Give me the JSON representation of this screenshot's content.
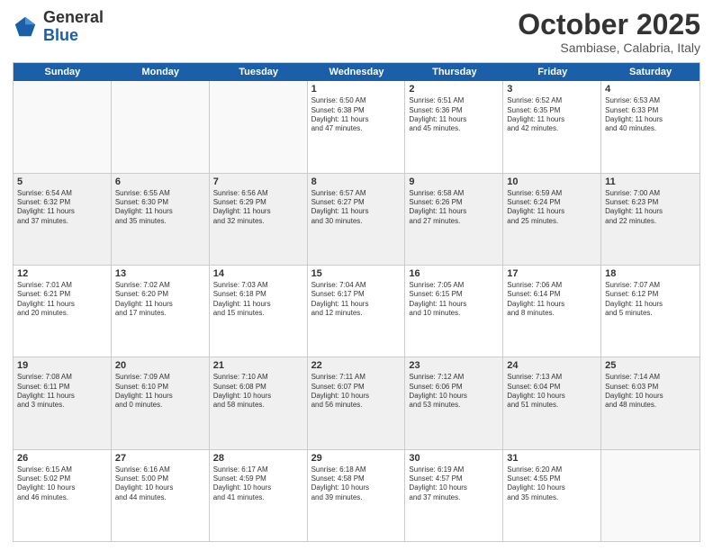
{
  "header": {
    "logo_general": "General",
    "logo_blue": "Blue",
    "month": "October 2025",
    "location": "Sambiase, Calabria, Italy"
  },
  "weekdays": [
    "Sunday",
    "Monday",
    "Tuesday",
    "Wednesday",
    "Thursday",
    "Friday",
    "Saturday"
  ],
  "rows": [
    {
      "shade": "white",
      "cells": [
        {
          "day": "",
          "empty": true
        },
        {
          "day": "",
          "empty": true
        },
        {
          "day": "",
          "empty": true
        },
        {
          "day": "1",
          "info": "Sunrise: 6:50 AM\nSunset: 6:38 PM\nDaylight: 11 hours\nand 47 minutes."
        },
        {
          "day": "2",
          "info": "Sunrise: 6:51 AM\nSunset: 6:36 PM\nDaylight: 11 hours\nand 45 minutes."
        },
        {
          "day": "3",
          "info": "Sunrise: 6:52 AM\nSunset: 6:35 PM\nDaylight: 11 hours\nand 42 minutes."
        },
        {
          "day": "4",
          "info": "Sunrise: 6:53 AM\nSunset: 6:33 PM\nDaylight: 11 hours\nand 40 minutes."
        }
      ]
    },
    {
      "shade": "shade",
      "cells": [
        {
          "day": "5",
          "info": "Sunrise: 6:54 AM\nSunset: 6:32 PM\nDaylight: 11 hours\nand 37 minutes."
        },
        {
          "day": "6",
          "info": "Sunrise: 6:55 AM\nSunset: 6:30 PM\nDaylight: 11 hours\nand 35 minutes."
        },
        {
          "day": "7",
          "info": "Sunrise: 6:56 AM\nSunset: 6:29 PM\nDaylight: 11 hours\nand 32 minutes."
        },
        {
          "day": "8",
          "info": "Sunrise: 6:57 AM\nSunset: 6:27 PM\nDaylight: 11 hours\nand 30 minutes."
        },
        {
          "day": "9",
          "info": "Sunrise: 6:58 AM\nSunset: 6:26 PM\nDaylight: 11 hours\nand 27 minutes."
        },
        {
          "day": "10",
          "info": "Sunrise: 6:59 AM\nSunset: 6:24 PM\nDaylight: 11 hours\nand 25 minutes."
        },
        {
          "day": "11",
          "info": "Sunrise: 7:00 AM\nSunset: 6:23 PM\nDaylight: 11 hours\nand 22 minutes."
        }
      ]
    },
    {
      "shade": "white",
      "cells": [
        {
          "day": "12",
          "info": "Sunrise: 7:01 AM\nSunset: 6:21 PM\nDaylight: 11 hours\nand 20 minutes."
        },
        {
          "day": "13",
          "info": "Sunrise: 7:02 AM\nSunset: 6:20 PM\nDaylight: 11 hours\nand 17 minutes."
        },
        {
          "day": "14",
          "info": "Sunrise: 7:03 AM\nSunset: 6:18 PM\nDaylight: 11 hours\nand 15 minutes."
        },
        {
          "day": "15",
          "info": "Sunrise: 7:04 AM\nSunset: 6:17 PM\nDaylight: 11 hours\nand 12 minutes."
        },
        {
          "day": "16",
          "info": "Sunrise: 7:05 AM\nSunset: 6:15 PM\nDaylight: 11 hours\nand 10 minutes."
        },
        {
          "day": "17",
          "info": "Sunrise: 7:06 AM\nSunset: 6:14 PM\nDaylight: 11 hours\nand 8 minutes."
        },
        {
          "day": "18",
          "info": "Sunrise: 7:07 AM\nSunset: 6:12 PM\nDaylight: 11 hours\nand 5 minutes."
        }
      ]
    },
    {
      "shade": "shade",
      "cells": [
        {
          "day": "19",
          "info": "Sunrise: 7:08 AM\nSunset: 6:11 PM\nDaylight: 11 hours\nand 3 minutes."
        },
        {
          "day": "20",
          "info": "Sunrise: 7:09 AM\nSunset: 6:10 PM\nDaylight: 11 hours\nand 0 minutes."
        },
        {
          "day": "21",
          "info": "Sunrise: 7:10 AM\nSunset: 6:08 PM\nDaylight: 10 hours\nand 58 minutes."
        },
        {
          "day": "22",
          "info": "Sunrise: 7:11 AM\nSunset: 6:07 PM\nDaylight: 10 hours\nand 56 minutes."
        },
        {
          "day": "23",
          "info": "Sunrise: 7:12 AM\nSunset: 6:06 PM\nDaylight: 10 hours\nand 53 minutes."
        },
        {
          "day": "24",
          "info": "Sunrise: 7:13 AM\nSunset: 6:04 PM\nDaylight: 10 hours\nand 51 minutes."
        },
        {
          "day": "25",
          "info": "Sunrise: 7:14 AM\nSunset: 6:03 PM\nDaylight: 10 hours\nand 48 minutes."
        }
      ]
    },
    {
      "shade": "white",
      "cells": [
        {
          "day": "26",
          "info": "Sunrise: 6:15 AM\nSunset: 5:02 PM\nDaylight: 10 hours\nand 46 minutes."
        },
        {
          "day": "27",
          "info": "Sunrise: 6:16 AM\nSunset: 5:00 PM\nDaylight: 10 hours\nand 44 minutes."
        },
        {
          "day": "28",
          "info": "Sunrise: 6:17 AM\nSunset: 4:59 PM\nDaylight: 10 hours\nand 41 minutes."
        },
        {
          "day": "29",
          "info": "Sunrise: 6:18 AM\nSunset: 4:58 PM\nDaylight: 10 hours\nand 39 minutes."
        },
        {
          "day": "30",
          "info": "Sunrise: 6:19 AM\nSunset: 4:57 PM\nDaylight: 10 hours\nand 37 minutes."
        },
        {
          "day": "31",
          "info": "Sunrise: 6:20 AM\nSunset: 4:55 PM\nDaylight: 10 hours\nand 35 minutes."
        },
        {
          "day": "",
          "empty": true
        }
      ]
    }
  ]
}
